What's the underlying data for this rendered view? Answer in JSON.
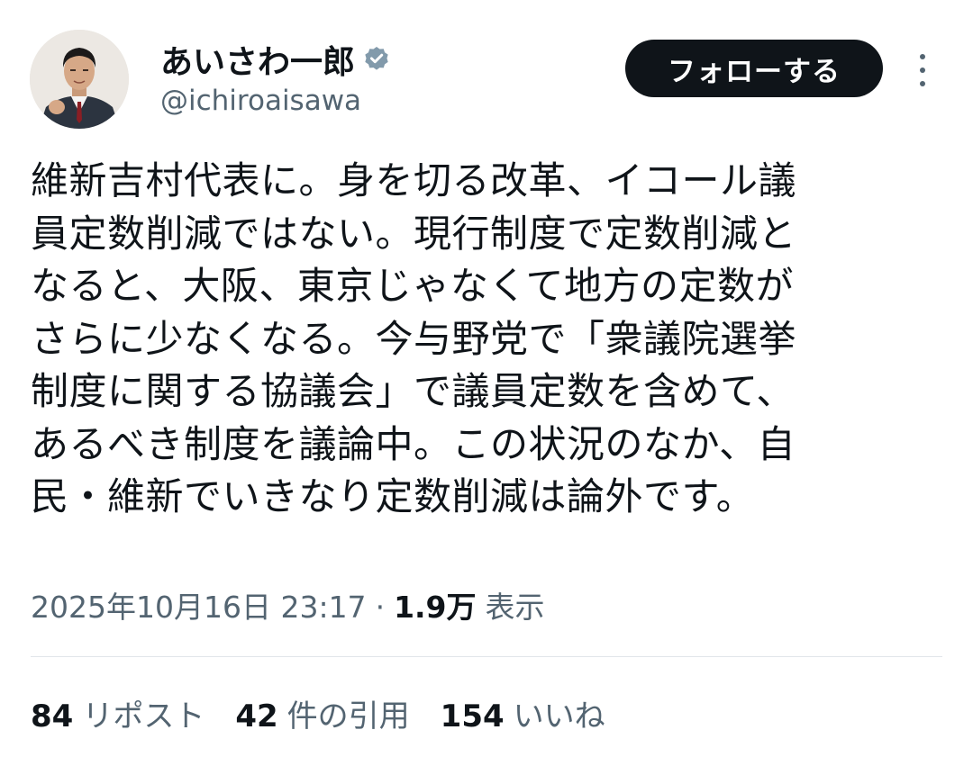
{
  "author": {
    "name": "あいさわ一郎",
    "handle": "@ichiroaisawa",
    "verified_color": "#829aab"
  },
  "follow_button": {
    "label": "フォローする"
  },
  "tweet": {
    "lines": [
      "維新吉村代表に。身を切る改革、イコール議",
      "員定数削減ではない。現行制度で定数削減と",
      "なると、大阪、東京じゃなくて地方の定数が",
      "さらに少なくなる。今与野党で「衆議院選挙",
      "制度に関する協議会」で議員定数を含めて、",
      "あるべき制度を議論中。この状況のなか、自",
      "民・維新でいきなり定数削減は論外です。"
    ]
  },
  "meta": {
    "timestamp": "2025年10月16日 23:17",
    "separator": "·",
    "views_count": "1.9万",
    "views_label": "表示"
  },
  "stats": {
    "reposts": {
      "count": "84",
      "label": "リポスト"
    },
    "quotes": {
      "count": "42",
      "label": "件の引用"
    },
    "likes": {
      "count": "154",
      "label": "いいね"
    }
  },
  "icons": {
    "verified": "verified-badge-icon",
    "more": "more-options-icon"
  },
  "colors": {
    "text_primary": "#0f1419",
    "text_secondary": "#536471",
    "button_bg": "#0f1419",
    "button_text": "#ffffff"
  }
}
